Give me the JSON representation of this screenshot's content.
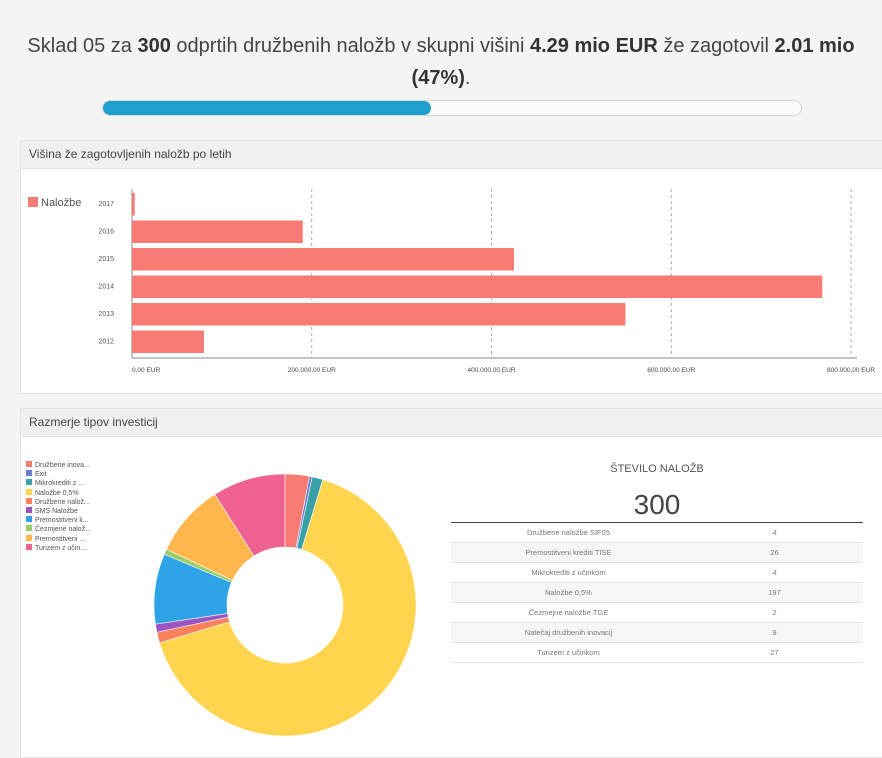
{
  "summary": {
    "part1": "Sklad 05 za ",
    "count": "300",
    "part2": " odprtih družbenih naložb v skupni višini ",
    "total": "4.29 mio EUR",
    "part3": " že zagotovil ",
    "secured": "2.01 mio (47%)",
    "part4": ".",
    "progress_fraction": 0.47
  },
  "bar_card": {
    "title": "Višina že zagotovljenih naložb po letih"
  },
  "pie_card": {
    "title": "Razmerje tipov investicij"
  },
  "stats": {
    "title": "ŠTEVILO NALOŽB",
    "total": "300",
    "rows": [
      {
        "label": "Družbene naložbe SIF05",
        "value": "4"
      },
      {
        "label": "Premostitveni krediti TISE",
        "value": "26"
      },
      {
        "label": "Mikrokrediti z učinkom",
        "value": "4"
      },
      {
        "label": "Naložbe 0,5%",
        "value": "197"
      },
      {
        "label": "Čezmejne naložbe TGE",
        "value": "2"
      },
      {
        "label": "Natečaj družbenih inovacij",
        "value": "9"
      },
      {
        "label": "Turizem z učinkom",
        "value": "27"
      }
    ]
  },
  "chart_data": [
    {
      "type": "bar",
      "orientation": "horizontal",
      "categories": [
        "2017",
        "2016",
        "2015",
        "2014",
        "2013",
        "2012"
      ],
      "series": [
        {
          "name": "Naložbe",
          "values": [
            3000,
            190000,
            425000,
            768000,
            549000,
            80000
          ],
          "color": "#f77b72"
        }
      ],
      "xlim": [
        0,
        800000
      ],
      "xticks": [
        0,
        200000,
        400000,
        600000,
        800000
      ],
      "xtick_labels": [
        "0,00 EUR",
        "200.000,00 EUR",
        "400.000,00 EUR",
        "600.000,00 EUR",
        "800.000,00 EUR"
      ],
      "grid": true,
      "legend": "top-left"
    },
    {
      "type": "pie",
      "donut": true,
      "legend": "left",
      "slices": [
        {
          "label": "Družbene inova...",
          "value": 9,
          "color": "#f77b72"
        },
        {
          "label": "Exit",
          "value": 1,
          "color": "#6b7bd1"
        },
        {
          "label": "Mikrokrediti z ...",
          "value": 4,
          "color": "#3aa0a8"
        },
        {
          "label": "Naložbe 0,5%",
          "value": 197,
          "color": "#ffd54f"
        },
        {
          "label": "Družbene nalož...",
          "value": 4,
          "color": "#f9825d"
        },
        {
          "label": "SMS Naložbe",
          "value": 3,
          "color": "#9c56c4"
        },
        {
          "label": "Premostitveni k...",
          "value": 26,
          "color": "#2fa3e8"
        },
        {
          "label": "Čezmjene nalož...",
          "value": 2,
          "color": "#9ccc65"
        },
        {
          "label": "Premostitveni ...",
          "value": 27,
          "color": "#ffb74d"
        },
        {
          "label": "Turizem z učin...",
          "value": 27,
          "color": "#f06292"
        }
      ]
    }
  ]
}
